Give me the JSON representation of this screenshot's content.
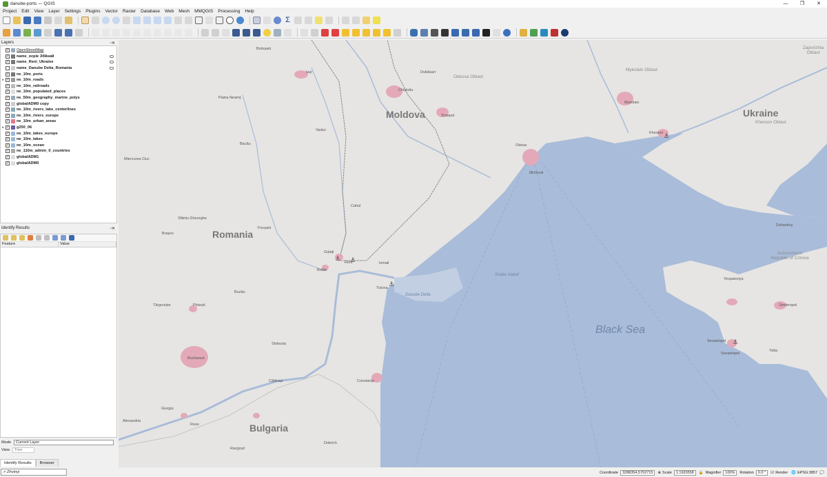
{
  "window": {
    "title": "danube-ports — QGIS",
    "controls": [
      "—",
      "❐",
      "✕"
    ]
  },
  "menu": [
    "Project",
    "Edit",
    "View",
    "Layer",
    "Settings",
    "Plugins",
    "Vector",
    "Raster",
    "Database",
    "Web",
    "Mesh",
    "MMQGIS",
    "Processing",
    "Help"
  ],
  "layers_panel": {
    "title": "Layers",
    "items": [
      {
        "name": "OpenStreetMap",
        "checked": true,
        "expand": "",
        "style": "ul",
        "sym": "#9aa9c0"
      },
      {
        "name": "name_осpie Збйний",
        "checked": true,
        "expand": "",
        "style": "",
        "sym": "#777"
      },
      {
        "name": "name_Reni_Ukraine",
        "checked": true,
        "expand": "",
        "style": "",
        "sym": "#777"
      },
      {
        "name": "name_Danube Delta_Romania",
        "checked": false,
        "expand": "",
        "style": "",
        "sym": "#ccc"
      },
      {
        "name": "ne_10m_ports",
        "checked": true,
        "expand": "",
        "style": "",
        "sym": "#777"
      },
      {
        "name": "ne_10m_roads",
        "checked": true,
        "expand": "▸",
        "style": "",
        "sym": "#999"
      },
      {
        "name": "ne_10m_railroads",
        "checked": true,
        "expand": "",
        "style": "",
        "sym": "#bbb"
      },
      {
        "name": "ne_10m_populated_places",
        "checked": true,
        "expand": "",
        "style": "",
        "sym": "#ddd"
      },
      {
        "name": "ne_50m_geography_marine_polys",
        "checked": true,
        "expand": "",
        "style": "",
        "sym": "#9ab"
      },
      {
        "name": "globalADM0 copy",
        "checked": true,
        "expand": "",
        "style": "",
        "sym": "#ccc"
      },
      {
        "name": "ne_10m_rivers_lake_centerlines",
        "checked": true,
        "expand": "",
        "style": "",
        "sym": "#8ab"
      },
      {
        "name": "ne_10m_rivers_europe",
        "checked": true,
        "expand": "",
        "style": "",
        "sym": "#8ab"
      },
      {
        "name": "ne_10m_urban_areas",
        "checked": true,
        "expand": "",
        "style": "",
        "sym": "#e8748a"
      },
      {
        "name": "g250_06",
        "checked": true,
        "expand": "▸",
        "style": "",
        "sym": "#6b5ea8"
      },
      {
        "name": "ne_10m_lakes_europe",
        "checked": true,
        "expand": "",
        "style": "",
        "sym": "#9ab8d8"
      },
      {
        "name": "ne_10m_lakes",
        "checked": true,
        "expand": "",
        "style": "",
        "sym": "#9ab8d8"
      },
      {
        "name": "ne_10m_ocean",
        "checked": true,
        "expand": "",
        "style": "",
        "sym": "#9ab8d8"
      },
      {
        "name": "ne_110m_admin_0_countries",
        "checked": true,
        "expand": "",
        "style": "",
        "sym": "#aaa"
      },
      {
        "name": "globalADM1",
        "checked": true,
        "expand": "",
        "style": "",
        "sym": "#ddd"
      },
      {
        "name": "globalADM0",
        "checked": true,
        "expand": "",
        "style": "",
        "sym": "#ddd"
      }
    ]
  },
  "identify_panel": {
    "title": "Identify Results",
    "col_feature": "Feature",
    "col_value": "Value"
  },
  "mode": {
    "label": "Mode",
    "value": "Current Layer",
    "view_label": "View",
    "view_value": "Tree"
  },
  "tabs": {
    "identify": "Identify Results",
    "browser": "Browser"
  },
  "locator": {
    "text": "> Zhvinyi"
  },
  "status": {
    "coord_label": "Coordinate",
    "coord_value": "3288354,5702715",
    "scale_label": "Scale",
    "scale_value": "1:1920558",
    "magnifier_label": "Magnifier",
    "magnifier_value": "100%",
    "rotation_label": "Rotation",
    "rotation_value": "0.0 °",
    "render_label": "Render",
    "crs": "EPSG:3857"
  },
  "map_labels": {
    "countries": {
      "moldova": "Moldova",
      "romania": "Romania",
      "ukraine": "Ukraine",
      "bulgaria": "Bulgaria"
    },
    "sea": "Black Sea",
    "regions": {
      "odessa_oblast": "Odessa Oblast",
      "mykolaiv_oblast": "Mykolaiv Oblast",
      "kherson_oblast": "Kherson Oblast",
      "zaporizhia": "Zaporizhia Oblast",
      "crimea": "Autonomous Republic of Crimea"
    },
    "water": {
      "danube_delta": "Danube Delta",
      "snake_island": "Snake Island"
    },
    "cities": {
      "iasi": "Iași",
      "botosani": "Botoșani",
      "chisinau": "Chișinău",
      "tiraspol": "Tiraspol",
      "dubasari": "Dubăsari",
      "mykolaiv": "Mykolaiv",
      "kherson": "Kherson",
      "odesa": "Odesa",
      "illichivsk": "Illichivsk",
      "bacau": "Bacău",
      "vaslui": "Vaslui",
      "piatra_neamt": "Piatra-Neamț",
      "miercurea_ciuc": "Miercurea Ciuc",
      "sfantu_gheorghe": "Sfântu Gheorghe",
      "brasov": "Brașov",
      "focsani": "Focșani",
      "cahul": "Cahul",
      "galati": "Galați",
      "reni": "Reni",
      "braila": "Brăila",
      "izmail": "Izmail",
      "tulcea": "Tulcea",
      "buzau": "Buzău",
      "targoviste": "Târgoviște",
      "ploiesti": "Ploiești",
      "bucharest": "Bucharest",
      "slobozia": "Slobozia",
      "calarasi": "Călărași",
      "constanta": "Constanța",
      "giurgiu": "Giurgiu",
      "ruse": "Ruse",
      "alexandria": "Alexandria",
      "razgrad": "Razgrad",
      "dobrich": "Dobrich",
      "dzhankoy": "Dzhankoy",
      "simferopol": "Simferopol",
      "yevpatoriya": "Yevpatoriya",
      "sevastopol": "Sevastopol",
      "yalta": "Yalta",
      "sevastopol_port": "Sevastopol"
    }
  },
  "colors": {
    "land": "#e6e5e3",
    "water": "#a9bcd9",
    "urban": "#e4a9b8",
    "border": "#8a8a8a",
    "accent": "#1a5fb4"
  }
}
